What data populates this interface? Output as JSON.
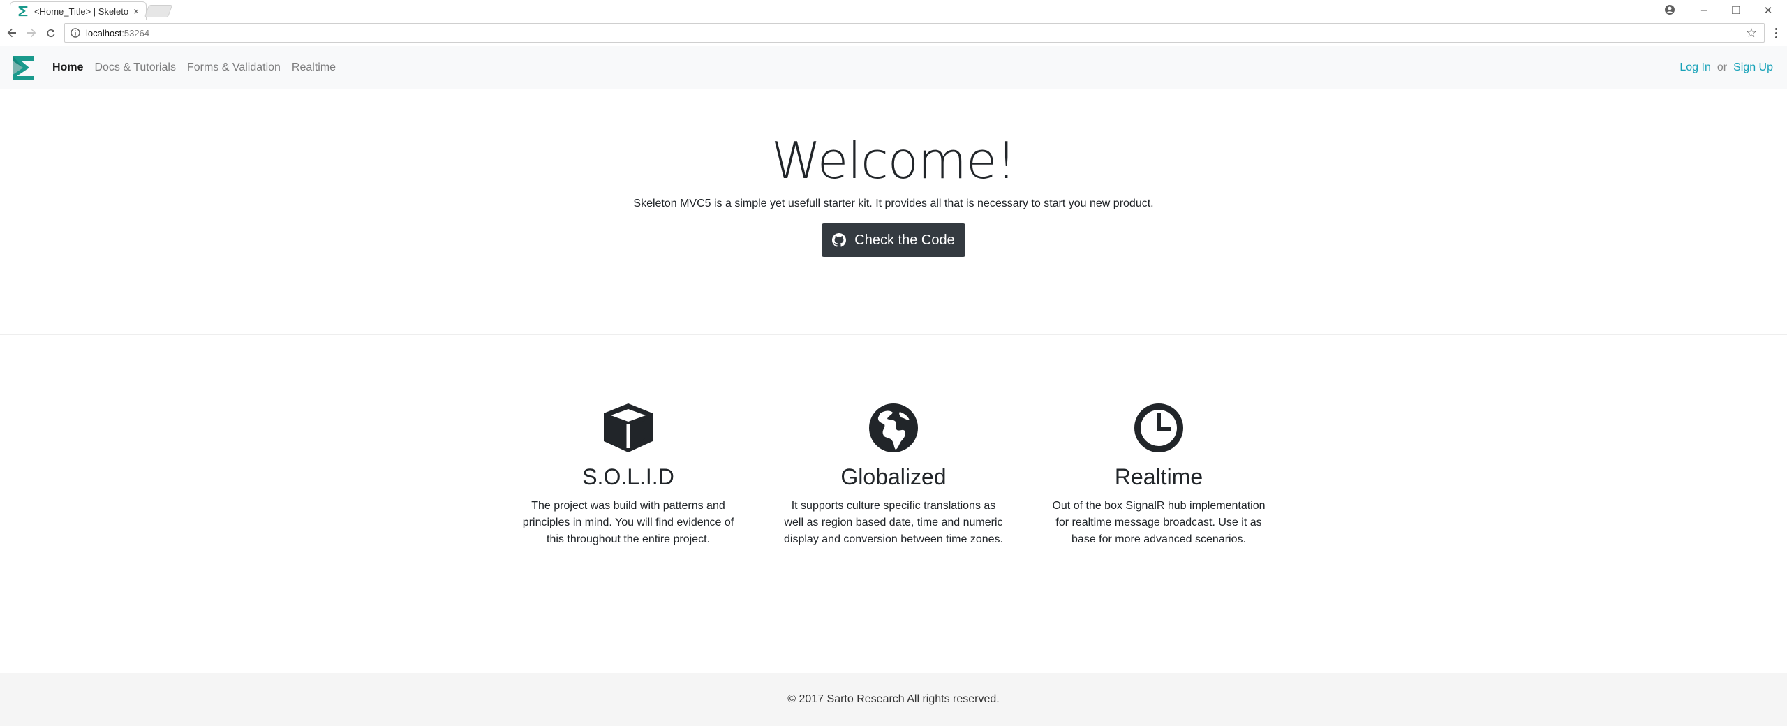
{
  "browser": {
    "tab_title": "<Home_Title> | Skeleton",
    "tab_close": "×",
    "url_host": "localhost",
    "url_port": ":53264",
    "window_controls": {
      "minimize": "–",
      "restore": "❐",
      "close": "✕"
    },
    "icons": [
      "back-icon",
      "forward-icon",
      "reload-icon",
      "info-icon",
      "star-icon",
      "menu-icon",
      "profile-icon"
    ]
  },
  "navbar": {
    "brand_color": "#1a9a8c",
    "links": [
      {
        "label": "Home",
        "active": true
      },
      {
        "label": "Docs & Tutorials",
        "active": false
      },
      {
        "label": "Forms & Validation",
        "active": false
      },
      {
        "label": "Realtime",
        "active": false
      }
    ],
    "login_label": "Log In",
    "or_label": "or",
    "signup_label": "Sign Up",
    "link_color": "#17a2b8"
  },
  "hero": {
    "title": "Welcome!",
    "lead": "Skeleton MVC5 is a simple yet usefull starter kit. It provides all that is necessary to start you new product.",
    "button_label": "Check the Code",
    "button_color": "#343a40"
  },
  "features": [
    {
      "icon": "cube-icon",
      "title": "S.O.L.I.D",
      "text": "The project was build with patterns and principles in mind. You will find evidence of this throughout the entire project."
    },
    {
      "icon": "globe-icon",
      "title": "Globalized",
      "text": "It supports culture specific translations as well as region based date, time and numeric display and conversion between time zones."
    },
    {
      "icon": "clock-icon",
      "title": "Realtime",
      "text": "Out of the box SignalR hub implementation for realtime message broadcast. Use it as base for more advanced scenarios."
    }
  ],
  "footer": {
    "text": "© 2017 Sarto Research All rights reserved."
  }
}
